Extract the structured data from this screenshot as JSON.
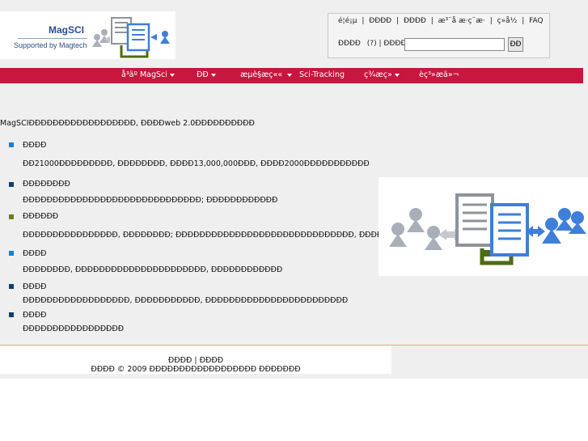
{
  "header": {
    "logo_line1": "MagSCI",
    "logo_line2": "Supported by Magtech",
    "top_links": [
      "é¦é¡µ",
      "|",
      "ÐÐÐÐ",
      "|",
      "ÐÐÐÐ",
      "|",
      "æ³¨å æ·ç¨æ·",
      "|",
      "ç»å½",
      "|",
      "FAQ"
    ],
    "login_label": "ÐÐÐÐ",
    "login_help": "(?)",
    "login_sep": "|",
    "login_label2": "ÐÐÐÐ",
    "search_value": "",
    "search_placeholder": "",
    "go_label": "ÐÐ"
  },
  "nav": {
    "items": [
      {
        "label": "å³äº MagSci",
        "dropdown": true
      },
      {
        "label": "ÐÐ",
        "dropdown": true
      },
      {
        "label": "æµè§æç««",
        "dropdown": true
      },
      {
        "label": "Sci-Tracking",
        "dropdown": false
      },
      {
        "label": "ç¾æç»",
        "dropdown": true
      },
      {
        "label": "èç³»æä»¬",
        "dropdown": false
      }
    ]
  },
  "main": {
    "intro": "MagSCIÐÐÐÐÐÐÐÐÐÐÐÐÐÐÐÐÐÐ, ÐÐÐÐweb 2.0ÐÐÐÐÐÐÐÐÐÐ",
    "items": [
      {
        "title": "ÐÐÐÐ",
        "desc": "ÐÐ21000ÐÐÐÐÐÐÐÐÐ, ÐÐÐÐÐÐÐÐ, ÐÐÐÐ13,000,000ÐÐÐ, ÐÐÐÐ2000ÐÐÐÐÐÐÐÐÐÐÐ",
        "color": "#1a7fd4"
      },
      {
        "title": "ÐÐÐÐÐÐÐÐ",
        "desc": "ÐÐÐÐÐÐÐÐÐÐÐÐÐÐÐÐÐÐÐÐÐÐÐÐÐÐÐÐÐÐ; ÐÐÐÐÐÐÐÐÐÐÐÐ",
        "color": "#0f3f6e"
      },
      {
        "title": "ÐÐÐÐÐÐ",
        "desc": "ÐÐÐÐÐÐÐÐÐÐÐÐÐÐÐÐ, ÐÐÐÐÐÐÐÐ; ÐÐÐÐÐÐÐÐÐÐÐÐÐÐÐÐÐÐÐÐÐÐÐÐÐÐÐÐÐÐ, ÐÐÐÐÐÐÐÐÐÐÐÐ",
        "color": "#6e7f1a"
      },
      {
        "title": "ÐÐÐÐ",
        "desc": "ÐÐÐÐÐÐÐÐ, ÐÐÐÐÐÐÐÐÐÐÐÐÐÐÐÐÐÐÐÐÐÐ, ÐÐÐÐÐÐÐÐÐÐÐÐ",
        "color": "#1a7fd4"
      },
      {
        "title": "ÐÐÐÐ",
        "desc": "ÐÐÐÐÐÐÐÐÐÐÐÐÐÐÐÐÐÐ, ÐÐÐÐÐÐÐÐÐÐÐ, ÐÐÐÐÐÐÐÐÐÐÐÐÐÐÐÐÐÐÐÐÐÐÐÐ",
        "color": "#0f3f6e"
      },
      {
        "title": "ÐÐÐÐ",
        "desc": "ÐÐÐÐÐÐÐÐÐÐÐÐÐÐÐÐÐ",
        "color": "#0f3f6e"
      }
    ]
  },
  "footer": {
    "links": "ÐÐÐÐ | ÐÐÐÐ",
    "copyright": "ÐÐÐÐ © 2009 ÐÐÐÐÐÐÐÐÐÐÐÐÐÐÐÐÐÐ ÐÐÐÐÐÐÐ"
  },
  "colors": {
    "nav_bg": "#c8163e",
    "logo_blue": "#2a4f8c",
    "accent_blue": "#3d7fd9",
    "accent_green": "#5c7a1a"
  }
}
